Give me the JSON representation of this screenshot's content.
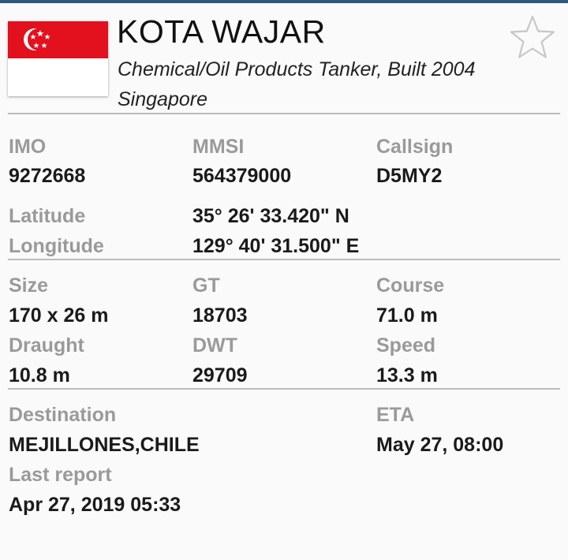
{
  "colors": {
    "flag_red": "#e3101d",
    "label_gray": "#9a9a9a",
    "value_black": "#1a1a1a",
    "accent_bar": "#2a5a7e"
  },
  "header": {
    "flag_icon": "singapore-flag-icon",
    "name": "KOTA WAJAR",
    "type_line": "Chemical/Oil Products Tanker, Built 2004",
    "country": "Singapore",
    "favorite_icon": "star-outline-icon"
  },
  "ids": {
    "imo_label": "IMO",
    "imo_value": "9272668",
    "mmsi_label": "MMSI",
    "mmsi_value": "564379000",
    "callsign_label": "Callsign",
    "callsign_value": "D5MY2"
  },
  "position": {
    "latitude_label": "Latitude",
    "latitude_value": "35° 26' 33.420\" N",
    "longitude_label": "Longitude",
    "longitude_value": "129° 40' 31.500\" E"
  },
  "dimensions": {
    "size_label": "Size",
    "size_value": "170 x 26 m",
    "gt_label": "GT",
    "gt_value": "18703",
    "course_label": "Course",
    "course_value": "71.0 m",
    "draught_label": "Draught",
    "draught_value": "10.8 m",
    "dwt_label": "DWT",
    "dwt_value": "29709",
    "speed_label": "Speed",
    "speed_value": "13.3 m"
  },
  "voyage": {
    "destination_label": "Destination",
    "destination_value": "MEJILLONES,CHILE",
    "eta_label": "ETA",
    "eta_value": "May 27, 08:00",
    "last_report_label": "Last report",
    "last_report_value": "Apr 27, 2019 05:33"
  }
}
